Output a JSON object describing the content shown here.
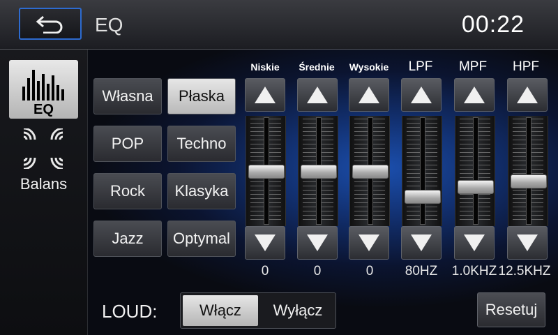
{
  "header": {
    "title": "EQ",
    "clock": "00:22",
    "back_icon": "back-arrow-icon"
  },
  "sidebar": {
    "eq_label": "EQ",
    "eq_icon": "equalizer-bars-icon",
    "balance_label": "Balans",
    "balance_icon": "speaker-waves-icon"
  },
  "presets": [
    {
      "label": "Własna",
      "active": false
    },
    {
      "label": "Płaska",
      "active": true
    },
    {
      "label": "POP",
      "active": false
    },
    {
      "label": "Techno",
      "active": false
    },
    {
      "label": "Rock",
      "active": false
    },
    {
      "label": "Klasyka",
      "active": false
    },
    {
      "label": "Jazz",
      "active": false
    },
    {
      "label": "Optymal",
      "active": false
    }
  ],
  "bands": [
    {
      "label": "Niskie",
      "value": "0",
      "level": 0.5
    },
    {
      "label": "Średnie",
      "value": "0",
      "level": 0.5
    },
    {
      "label": "Wysokie",
      "value": "0",
      "level": 0.5
    },
    {
      "label": "LPF",
      "value": "80HZ",
      "level": 0.22
    },
    {
      "label": "MPF",
      "value": "1.0KHZ",
      "level": 0.33
    },
    {
      "label": "HPF",
      "value": "12.5KHZ",
      "level": 0.39
    }
  ],
  "loud": {
    "label": "LOUD:",
    "on_label": "Włącz",
    "off_label": "Wyłącz",
    "selected": "on"
  },
  "reset_label": "Resetuj",
  "colors": {
    "accent": "#2d6bd0",
    "background_glow": "#1b4fae"
  }
}
